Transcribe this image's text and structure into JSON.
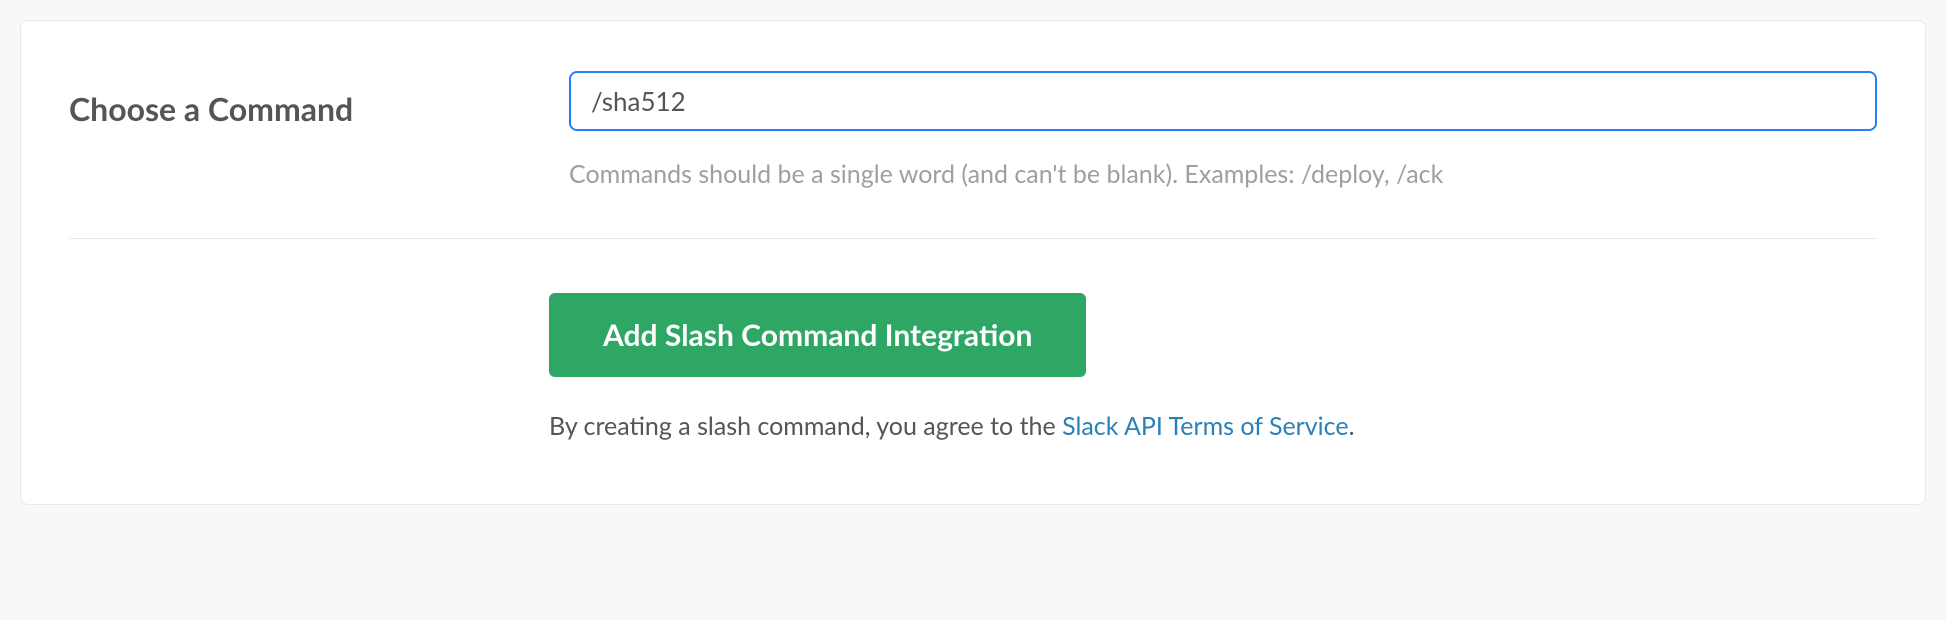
{
  "form": {
    "label": "Choose a Command",
    "command_value": "/sha512",
    "helper": "Commands should be a single word (and can't be blank). Examples: /deploy, /ack"
  },
  "action": {
    "button_label": "Add Slash Command Integration",
    "agreement_prefix": "By creating a slash command, you agree to the ",
    "agreement_link": "Slack API Terms of Service",
    "agreement_suffix": "."
  }
}
